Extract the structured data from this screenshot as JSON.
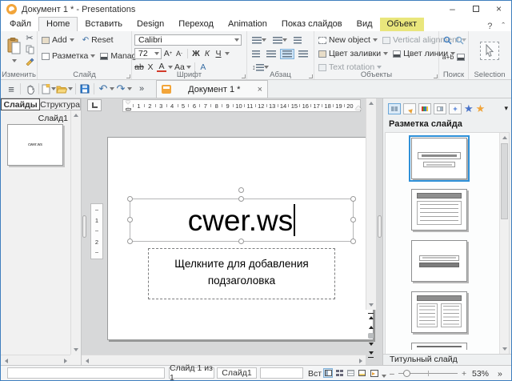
{
  "window": {
    "title": "Документ 1 * - Presentations",
    "minimize": "–",
    "close": "×",
    "help": "?",
    "collapse": "ˆ"
  },
  "menu": {
    "tabs": [
      {
        "label": "Файл"
      },
      {
        "label": "Home",
        "active": true
      },
      {
        "label": "Вставить"
      },
      {
        "label": "Design"
      },
      {
        "label": "Переход"
      },
      {
        "label": "Animation"
      },
      {
        "label": "Показ слайдов"
      },
      {
        "label": "Вид"
      },
      {
        "label": "Объект",
        "highlighted": true
      }
    ]
  },
  "ribbon": {
    "edit": {
      "label": "Изменить"
    },
    "slide": {
      "label": "Слайд",
      "add": "Add",
      "reset": "Reset",
      "layout": "Разметка",
      "manage": "Manage"
    },
    "font": {
      "label": "Шрифт",
      "family": "Calibri",
      "size": "72",
      "bold": "Ж",
      "italic": "К",
      "underline": "Ч",
      "strike": "ab",
      "subscript": "X",
      "color": "A",
      "case_btn": "Aa",
      "char_style": "A"
    },
    "paragraph": {
      "label": "Абзац"
    },
    "objects": {
      "label": "Объекты",
      "new_object": "New object",
      "vertical_alignment": "Vertical alignment",
      "fill_color": "Цвет заливки",
      "line_color": "Цвет линии",
      "text_rotation": "Text rotation"
    },
    "search": {
      "label": "Поиск",
      "replace": "a+b"
    },
    "selection": {
      "label": "Selection"
    }
  },
  "quickbar": {
    "menu_icon": "≡",
    "overflow": "»",
    "undo": "↶",
    "redo": "↷",
    "doc_tab": {
      "label": "Документ 1 *",
      "close": "×"
    }
  },
  "left_panel": {
    "tabs": [
      {
        "label": "Слайды",
        "active": true
      },
      {
        "label": "Структура"
      }
    ],
    "slide_label": "Слайд1",
    "thumbnail_text": "cwer.ws"
  },
  "canvas": {
    "ruler_numbers": [
      "1",
      "2",
      "3",
      "4",
      "5",
      "6",
      "7",
      "8",
      "9",
      "10",
      "11",
      "12",
      "13",
      "14",
      "15",
      "16",
      "17",
      "18",
      "19",
      "20"
    ],
    "vruler_numbers": [
      "1",
      "2"
    ],
    "title_text": "cwer.ws",
    "subtitle_placeholder": "Щелкните для добавления подзаголовка"
  },
  "right_panel": {
    "heading": "Разметка слайда",
    "layouts": [
      {
        "name": "title-slide",
        "selected": true
      },
      {
        "name": "title-content",
        "selected": false
      },
      {
        "name": "centered-text",
        "selected": false
      },
      {
        "name": "two-content",
        "selected": false
      },
      {
        "name": "title-partial",
        "selected": false
      }
    ],
    "footer_label": "Титульный слайд"
  },
  "status_bar": {
    "slide_position": "Слайд 1 из 1",
    "slide_name": "Слайд1",
    "insert_mode": "Вст",
    "zoom_level": "53%",
    "more": "»"
  },
  "colors": {
    "accent_blue": "#2e90d8",
    "highlight_yellow": "#e9e67c",
    "logo_orange": "#f2a53a",
    "save_blue": "#2d7dd2",
    "folder_yellow": "#f2c14e",
    "font_color_red": "#d23b2b",
    "star_blue": "#4a74c9",
    "star_orange": "#f0a43a"
  }
}
